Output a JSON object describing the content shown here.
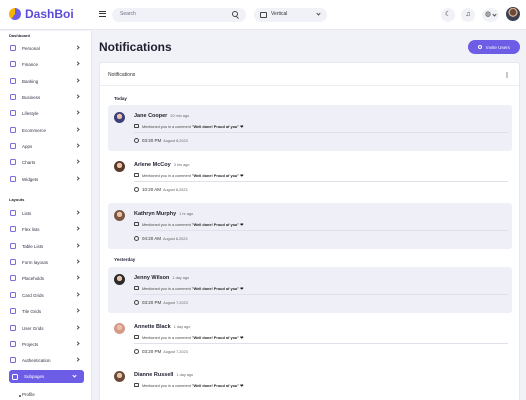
{
  "app": {
    "name": "DashBoi"
  },
  "header": {
    "search_placeholder": "Search",
    "layout_value": "Vertical"
  },
  "sidebar": {
    "sections": [
      {
        "title": "Dashboard",
        "items": [
          "Personal",
          "Finance",
          "Banking",
          "Business",
          "Lifestyle",
          "Ecommerce",
          "Apps",
          "Charts",
          "Widgets"
        ]
      },
      {
        "title": "Layouts",
        "items": [
          "Lists",
          "Flex lists",
          "Table Lists",
          "Form layouts",
          "Placeholds",
          "Card Grids",
          "Tile Grids",
          "User Grids",
          "Projects",
          "Authentication"
        ]
      }
    ],
    "active": {
      "label": "Subpages"
    },
    "sub_items": [
      "Profile"
    ]
  },
  "page": {
    "title": "Notifications",
    "invite_button": "Invite Users"
  },
  "card": {
    "title": "Notifications"
  },
  "groups": [
    "Today",
    "Yesterday"
  ],
  "notifications": [
    {
      "name": "Jane Cooper",
      "ago": "20 min ago",
      "text": "Mentioned you in a comment",
      "quote": "\"Well done! Proud of you\" ❤",
      "time": "03:20 PM",
      "date": "August 8,2023",
      "unread": true,
      "avatar_color": "#3c3f7a"
    },
    {
      "name": "Arlene McCoy",
      "ago": "3 hrs ago",
      "text": "Mentioned you in a comment",
      "quote": "\"Well done! Proud of you\" ❤",
      "time": "10:20 AM",
      "date": "August 8,2023",
      "unread": false,
      "avatar_color": "#5b3a2b"
    },
    {
      "name": "Kathryn Murphy",
      "ago": "1 hr ago",
      "text": "Mentioned you in a comment",
      "quote": "\"Well done! Proud of you\" ❤",
      "time": "04:20 AM",
      "date": "August 8,2023",
      "unread": true,
      "avatar_color": "#7a5643"
    },
    {
      "name": "Jenny Wilson",
      "ago": "1 day ago",
      "text": "Mentioned you in a comment",
      "quote": "\"Well done! Proud of you\" ❤",
      "time": "03:20 PM",
      "date": "August 7,2023",
      "unread": true,
      "avatar_color": "#2b2b2b"
    },
    {
      "name": "Annette Black",
      "ago": "1 day ago",
      "text": "Mentioned you in a comment",
      "quote": "\"Well done! Proud of you\" ❤",
      "time": "03:20 PM",
      "date": "August 7,2023",
      "unread": false,
      "avatar_color": "#d59a8a"
    },
    {
      "name": "Dianne Russell",
      "ago": "1 day ago",
      "text": "Mentioned you in a comment",
      "quote": "\"Well done! Proud of you\" ❤",
      "time": "",
      "date": "",
      "unread": false,
      "avatar_color": "#6b4a37"
    }
  ],
  "icons": [
    "menu-icon",
    "search-icon",
    "layout-icon",
    "moon-icon",
    "bell-icon",
    "globe-icon",
    "user-add-icon",
    "more-icon",
    "message-icon",
    "clock-icon"
  ]
}
